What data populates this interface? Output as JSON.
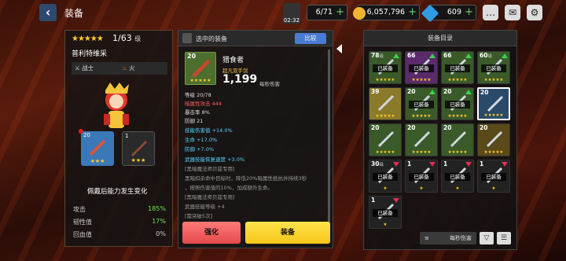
{
  "header": {
    "title": "装备",
    "time": "02:32"
  },
  "resources": {
    "stamina": "6/71",
    "gold": "6,057,796",
    "gems": "609"
  },
  "hero": {
    "stars": "★★★★★",
    "level": "1/63",
    "level_unit": "级",
    "name": "普利特维采",
    "class": "战士",
    "element": "火",
    "slot1_level": "20",
    "slot1_stars": "★★★",
    "slot2_level": "1",
    "slot2_stars": "★★★",
    "change_title": "佩戴后能力发生变化",
    "stats": [
      {
        "label": "攻击",
        "value": "185%"
      },
      {
        "label": "韧性值",
        "value": "17%"
      },
      {
        "label": "回血值",
        "value": "0%"
      }
    ]
  },
  "selected": {
    "header": "选中的装备",
    "compare": "比较",
    "level": "20",
    "stars": "★★★★★",
    "name": "猎食者",
    "type": "超凡双手剑",
    "dps": "1,199",
    "dps_label": "每秒伤害",
    "lines": [
      "等级  20/78",
      "暗属性攻击  444",
      "暴击率  8%",
      "防御  21",
      "技能伤害值  +14.0%",
      "生命  +17.0%",
      "防御  +7.0%",
      "武器技能恢复速度  +3.0%",
      "[黑暗魔法师贝兹专用]",
      "黑暗扣杀命中目标时，降低20%暗属性抵抗并持续3秒",
      "，按照伤害值的10%，加成额外生命。",
      "[黑暗魔法师贝兹专用]",
      "武器技能等级  +4",
      "[需突破5次]"
    ],
    "upgrade": "强化",
    "equip": "装备"
  },
  "inventory": {
    "title": "装备目录",
    "equipped_label": "已装备",
    "items": [
      {
        "level": "78",
        "unit": "级",
        "equipped": true,
        "stars": "★★★★★",
        "mark": "up",
        "color": "#3a5a2a"
      },
      {
        "level": "66",
        "unit": "",
        "equipped": true,
        "stars": "★★★★★",
        "mark": "up",
        "color": "#5a2a6a"
      },
      {
        "level": "66",
        "unit": "",
        "equipped": true,
        "stars": "★★★★★",
        "mark": "up",
        "color": "#3a5a2a"
      },
      {
        "level": "60",
        "unit": "级",
        "equipped": true,
        "stars": "★★★★★",
        "mark": "up",
        "color": "#3a5a2a"
      },
      {
        "level": "39",
        "unit": "",
        "equipped": false,
        "stars": "★★★★★",
        "mark": "",
        "color": "#8a7a2a"
      },
      {
        "level": "20",
        "unit": "",
        "equipped": true,
        "stars": "★★★★★",
        "mark": "up",
        "color": "#3a5a2a"
      },
      {
        "level": "20",
        "unit": "",
        "equipped": true,
        "stars": "★★★★★",
        "mark": "up",
        "color": "#3a5a2a"
      },
      {
        "level": "20",
        "unit": "",
        "equipped": false,
        "stars": "★★★★★",
        "mark": "",
        "color": "#2a4a6a",
        "selected": true
      },
      {
        "level": "20",
        "unit": "",
        "equipped": false,
        "stars": "★★★★★",
        "mark": "",
        "color": "#3a5a2a"
      },
      {
        "level": "20",
        "unit": "",
        "equipped": false,
        "stars": "★★★★★",
        "mark": "",
        "color": "#3a5a2a"
      },
      {
        "level": "20",
        "unit": "",
        "equipped": false,
        "stars": "★★★★★",
        "mark": "",
        "color": "#3a5a2a"
      },
      {
        "level": "20",
        "unit": "",
        "equipped": false,
        "stars": "★★★★★",
        "mark": "",
        "color": "#5a4a1a"
      },
      {
        "level": "30",
        "unit": "级",
        "equipped": true,
        "stars": "★",
        "mark": "down",
        "color": "#222"
      },
      {
        "level": "1",
        "unit": "",
        "equipped": true,
        "stars": "★",
        "mark": "down",
        "color": "#222"
      },
      {
        "level": "1",
        "unit": "",
        "equipped": true,
        "stars": "★",
        "mark": "down",
        "color": "#222"
      },
      {
        "level": "1",
        "unit": "",
        "equipped": true,
        "stars": "★",
        "mark": "down",
        "color": "#222"
      },
      {
        "level": "1",
        "unit": "",
        "equipped": true,
        "stars": "★",
        "mark": "down",
        "color": "#222"
      }
    ],
    "sort_label": "每秒伤害"
  }
}
